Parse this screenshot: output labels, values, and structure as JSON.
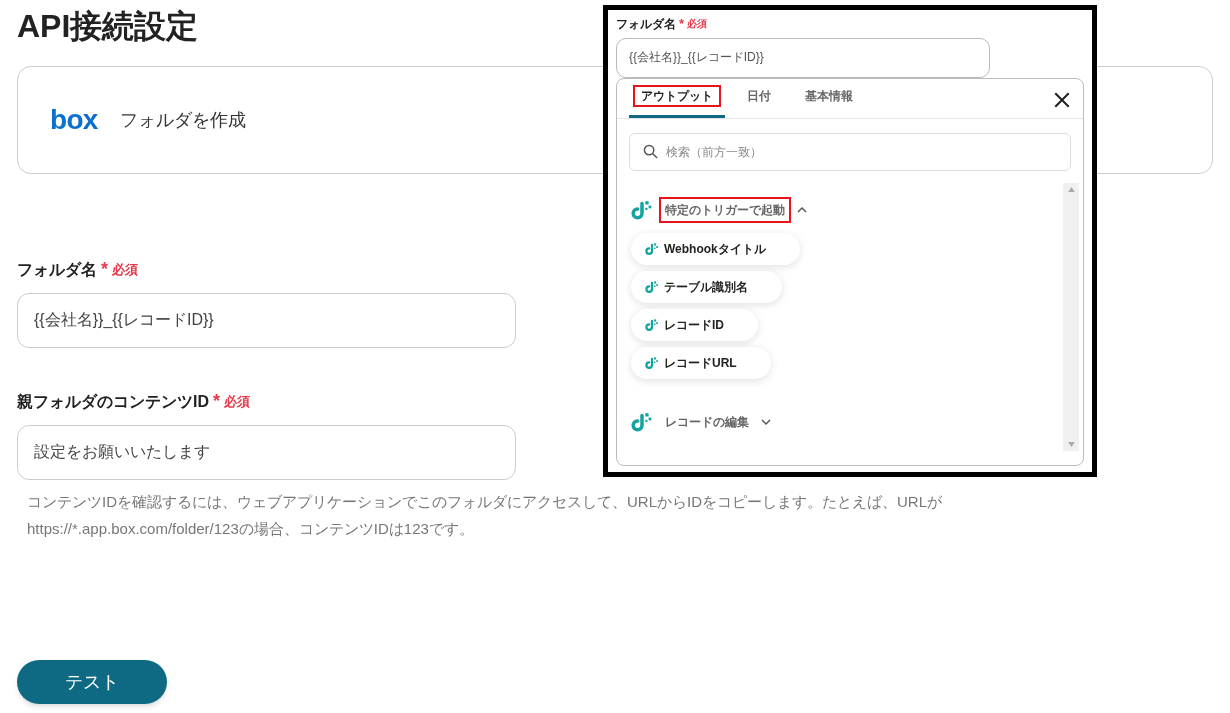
{
  "title": "API接続設定",
  "app_card": {
    "logo": "box",
    "action": "フォルダを作成"
  },
  "fields": [
    {
      "label": "フォルダ名",
      "required_mark": "*",
      "required_text": "必須",
      "value": "{{会社名}}_{{レコードID}}"
    },
    {
      "label": "親フォルダのコンテンツID",
      "required_mark": "*",
      "required_text": "必須",
      "value": "設定をお願いいたします"
    }
  ],
  "help_text": "コンテンツIDを確認するには、ウェブアプリケーションでこのフォルダにアクセスして、URLからIDをコピーします。たとえば、URLがhttps://*.app.box.com/folder/123の場合、コンテンツIDは123です。",
  "test_button": "テスト",
  "inset": {
    "field": {
      "label": "フォルダ名",
      "required_mark": "*",
      "required_text": "必須",
      "value": "{{会社名}}_{{レコードID}}"
    },
    "tabs": [
      {
        "label": "アウトプット",
        "selected": true,
        "highlighted": true
      },
      {
        "label": "日付",
        "selected": false,
        "highlighted": false
      },
      {
        "label": "基本情報",
        "selected": false,
        "highlighted": false
      }
    ],
    "search": {
      "placeholder": "検索（前方一致）"
    },
    "groups": [
      {
        "title": "特定のトリガーで起動",
        "expanded": true,
        "highlighted": true,
        "items": [
          "Webhookタイトル",
          "テーブル識別名",
          "レコードID",
          "レコードURL"
        ]
      },
      {
        "title": "レコードの編集",
        "expanded": false,
        "highlighted": false
      }
    ]
  }
}
